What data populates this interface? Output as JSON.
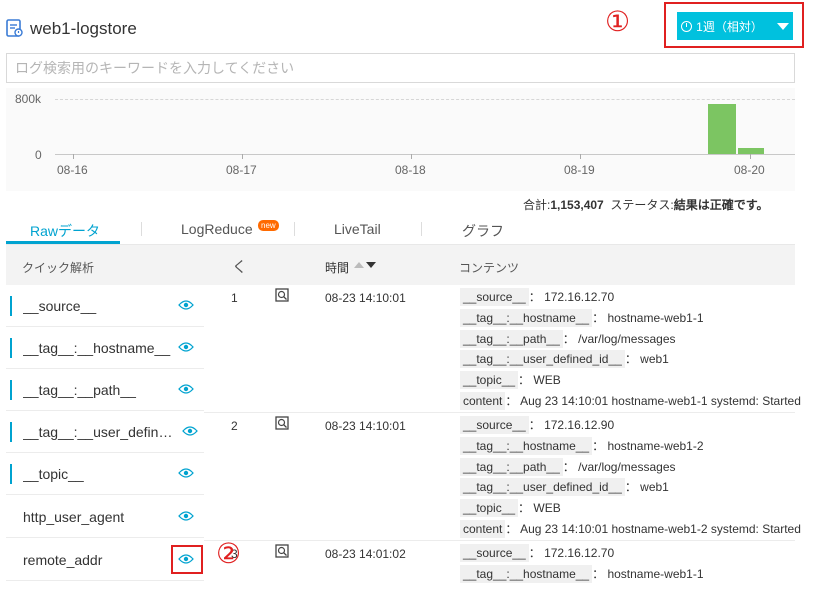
{
  "header": {
    "logstore_name": "web1-logstore",
    "time_range_label": "1週（相対）",
    "annotation_1": "①"
  },
  "search": {
    "placeholder": "ログ検索用のキーワードを入力してください",
    "value": ""
  },
  "chart_data": {
    "type": "bar",
    "x": [
      "08-16",
      "08-17",
      "08-18",
      "08-19",
      "08-20"
    ],
    "ytick_labels": [
      "800k",
      "0"
    ],
    "ylim": [
      0,
      800000
    ],
    "bars": [
      {
        "label": "08-20 (early)",
        "value": 730000
      },
      {
        "label": "08-20 (late)",
        "value": 80000
      }
    ],
    "grid": "dashed top line"
  },
  "stats": {
    "total_label": "合計:",
    "total_value": "1,153,407",
    "status_label": "ステータス:",
    "status_value": "結果は正確です。"
  },
  "tabs": [
    {
      "label": "Rawデータ",
      "active": true
    },
    {
      "label": "LogReduce",
      "badge": "new"
    },
    {
      "label": "LiveTail"
    },
    {
      "label": "グラフ"
    }
  ],
  "quick_analysis": {
    "title": "クイック解析",
    "items": [
      {
        "label": "__source__"
      },
      {
        "label": "__tag__:__hostname__"
      },
      {
        "label": "__tag__:__path__"
      },
      {
        "label": "__tag__:__user_defined_id__"
      },
      {
        "label": "__topic__"
      },
      {
        "label": "http_user_agent"
      },
      {
        "label": "remote_addr"
      }
    ]
  },
  "table": {
    "back_label": "く",
    "time_header": "時間",
    "contents_header": "コンテンツ",
    "rows": [
      {
        "num": "1",
        "time": "08-23 14:10:01",
        "fields": [
          {
            "key": "__source__",
            "value": "172.16.12.70"
          },
          {
            "key": "__tag__:__hostname__",
            "value": "hostname-web1-1"
          },
          {
            "key": "__tag__:__path__",
            "value": "/var/log/messages"
          },
          {
            "key": "__tag__:__user_defined_id__",
            "value": "web1"
          },
          {
            "key": "__topic__",
            "value": "WEB"
          },
          {
            "key": "content",
            "value": "Aug 23 14:10:01 hostname-web1-1 systemd: Started"
          }
        ]
      },
      {
        "num": "2",
        "time": "08-23 14:10:01",
        "fields": [
          {
            "key": "__source__",
            "value": "172.16.12.90"
          },
          {
            "key": "__tag__:__hostname__",
            "value": "hostname-web1-2"
          },
          {
            "key": "__tag__:__path__",
            "value": "/var/log/messages"
          },
          {
            "key": "__tag__:__user_defined_id__",
            "value": "web1"
          },
          {
            "key": "__topic__",
            "value": "WEB"
          },
          {
            "key": "content",
            "value": "Aug 23 14:10:01 hostname-web1-2 systemd: Started"
          }
        ]
      },
      {
        "num": "3",
        "time": "08-23 14:01:02",
        "fields": [
          {
            "key": "__source__",
            "value": "172.16.12.70"
          },
          {
            "key": "__tag__:__hostname__",
            "value": "hostname-web1-1"
          }
        ]
      }
    ]
  },
  "annotations": {
    "annotation_2": "②"
  }
}
